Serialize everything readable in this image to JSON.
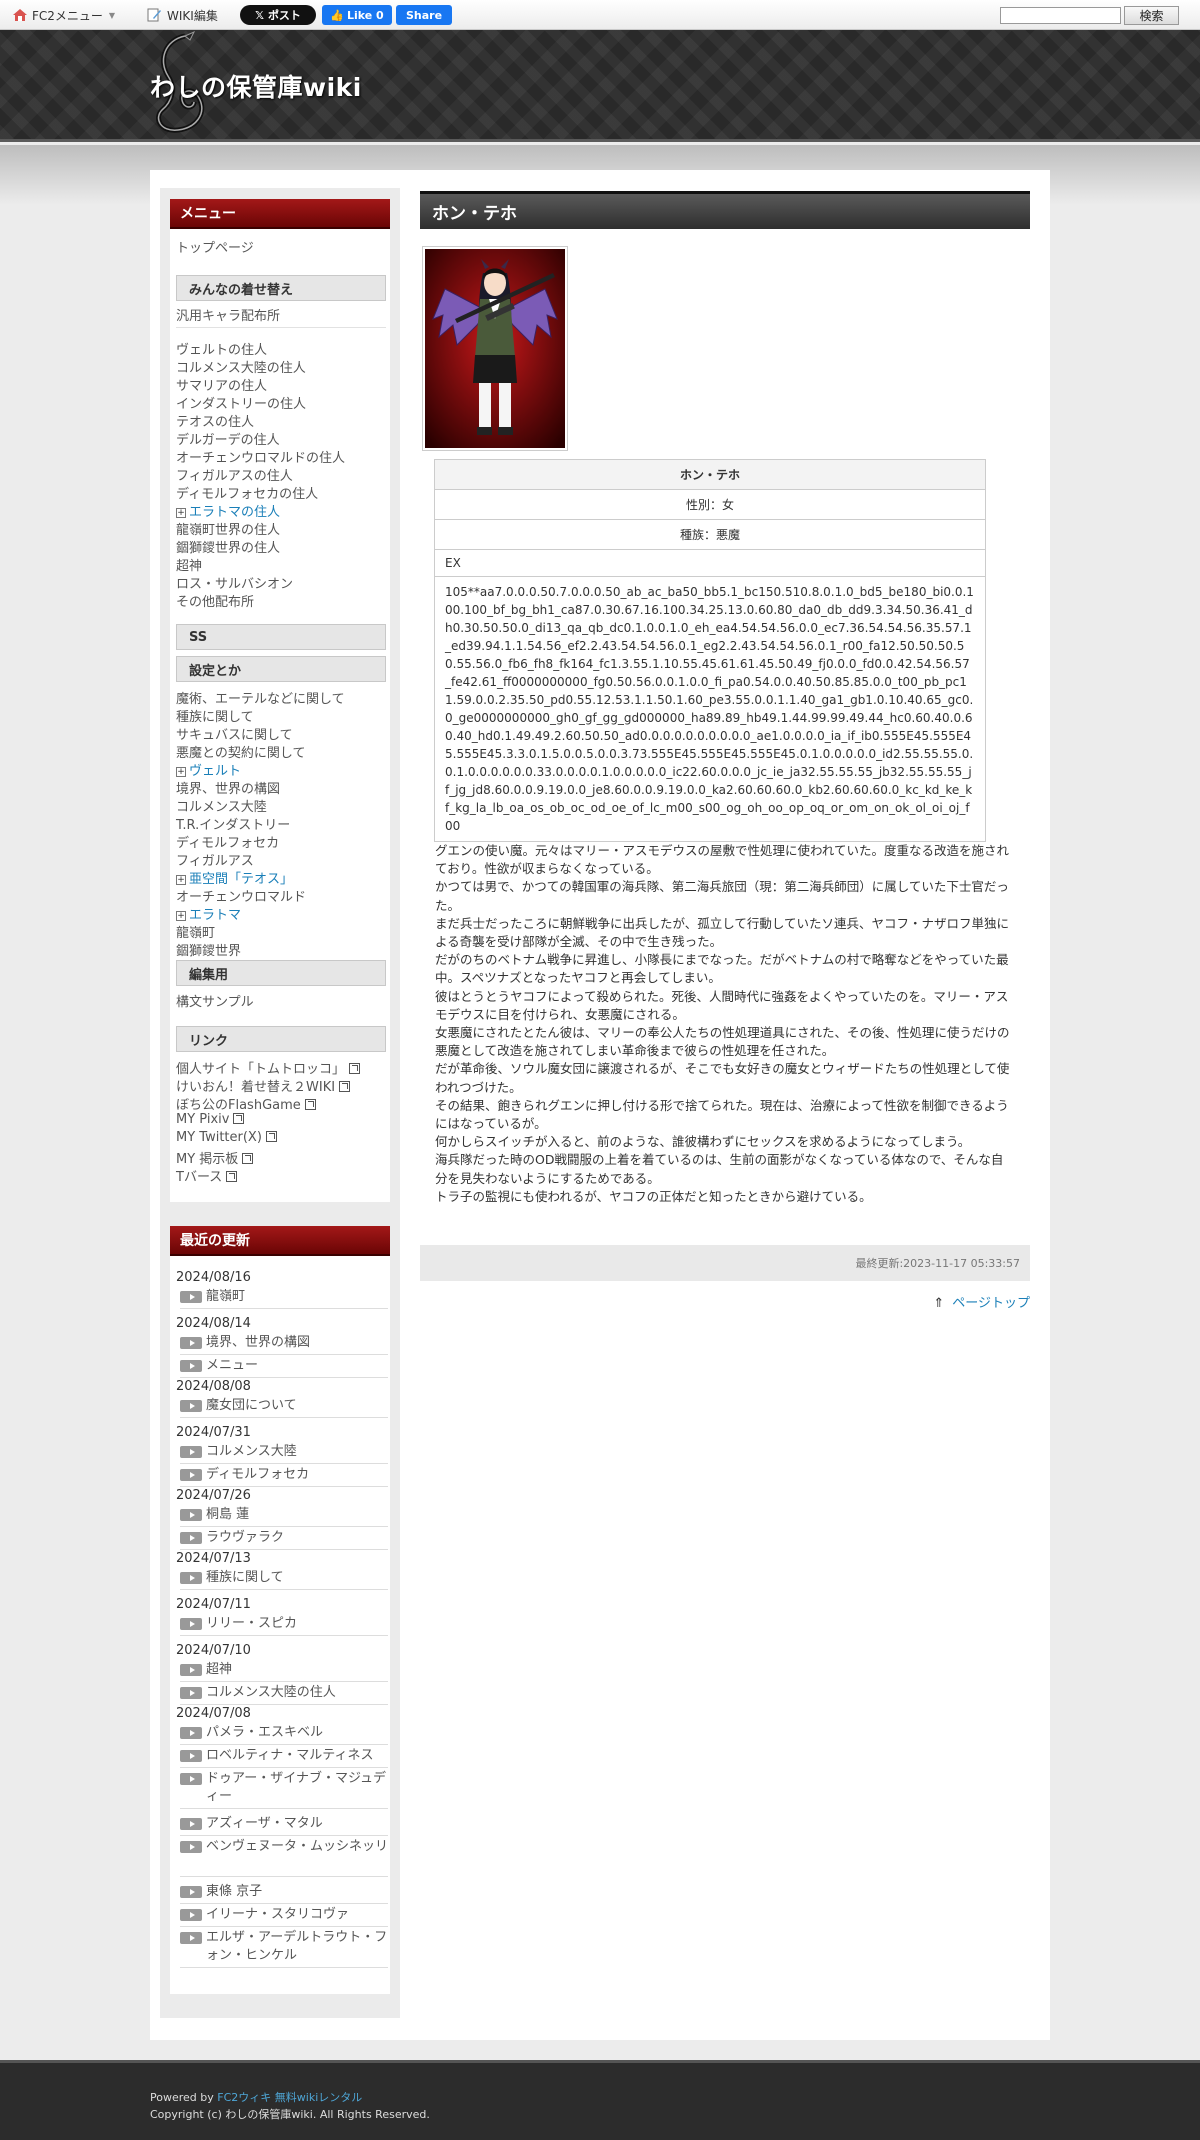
{
  "topbar": {
    "fc2_menu": "FC2メニュー",
    "wiki_edit": "WIKI編集",
    "x_post": "ポスト",
    "like": "Like 0",
    "share": "Share",
    "search_button": "検索"
  },
  "site": {
    "title": "わしの保管庫wiki"
  },
  "menu": {
    "title": "メニュー",
    "top_page": "トップページ",
    "section_dressup": "みんなの着せ替え",
    "generic_chars": "汎用キャラ配布所",
    "residents": [
      "ヴェルトの住人",
      "コルメンス大陸の住人",
      "サマリアの住人",
      "インダストリーの住人",
      "テオスの住人",
      "デルガーデの住人",
      "オーチェンウロマルドの住人",
      "フィガルアスの住人",
      "ディモルフォセカの住人"
    ],
    "eratoma_residents": "エラトマの住人",
    "residents2": [
      "龍嶺町世界の住人",
      "錮獅鑁世界の住人",
      "超神",
      "ロス・サルバシオン",
      "その他配布所"
    ],
    "section_ss": "SS",
    "section_settings": "設定とか",
    "settings1": [
      "魔術、エーテルなどに関して",
      "種族に関して",
      "サキュバスに関して",
      "悪魔との契約に関して"
    ],
    "velt": "ヴェルト",
    "settings2": [
      "境界、世界の構図",
      "コルメンス大陸",
      "T.R.インダストリー",
      "ディモルフォセカ",
      "フィガルアス"
    ],
    "theos": "亜空間「テオス」",
    "orchen": "オーチェンウロマルド",
    "eratoma": "エラトマ",
    "settings3": [
      "龍嶺町",
      "錮獅鑁世界"
    ],
    "section_edit": "編集用",
    "edit_sample": "構文サンプル",
    "section_links": "リンク",
    "links": [
      "個人サイト「トムトロッコ」",
      "けいおん！着せ替え２WIKI",
      "ぼち公のFlashGame",
      "MY Pixiv",
      "MY Twitter(X)",
      "MY 掲示板",
      "Tバース"
    ]
  },
  "recent": {
    "title": "最近の更新",
    "groups": [
      {
        "date": "2024/08/16",
        "items": [
          "龍嶺町"
        ]
      },
      {
        "date": "2024/08/14",
        "items": [
          "境界、世界の構図",
          "メニュー"
        ]
      },
      {
        "date": "2024/08/08",
        "items": [
          "魔女団について"
        ]
      },
      {
        "date": "2024/07/31",
        "items": [
          "コルメンス大陸",
          "ディモルフォセカ"
        ]
      },
      {
        "date": "2024/07/26",
        "items": [
          "桐島 蓮",
          "ラウヴァラク"
        ]
      },
      {
        "date": "2024/07/13",
        "items": [
          "種族に関して"
        ]
      },
      {
        "date": "2024/07/11",
        "items": [
          "リリー・スピカ"
        ]
      },
      {
        "date": "2024/07/10",
        "items": [
          "超神",
          "コルメンス大陸の住人"
        ]
      },
      {
        "date": "2024/07/08",
        "items": [
          "パメラ・エスキベル",
          "ロベルティナ・マルティネス",
          "ドゥアー・ザイナブ・マジュディー",
          "アズィーザ・マタル",
          "ベンヴェヌータ・ムッシネッリ",
          "東條 京子",
          "イリーナ・スタリコヴァ",
          "エルザ・アーデルトラウト・フォン・ヒンケル"
        ]
      }
    ]
  },
  "page": {
    "title": "ホン・テホ",
    "table_title": "ホン・テホ",
    "gender": "性別：女",
    "race": "種族：悪魔",
    "ex_label": "EX",
    "code": "105**aa7.0.0.0.50.7.0.0.0.50_ab_ac_ba50_bb5.1_bc150.510.8.0.1.0_bd5_be180_bi0.0.100.100_bf_bg_bh1_ca87.0.30.67.16.100.34.25.13.0.60.80_da0_db_dd9.3.34.50.36.41_dh0.30.50.50.0_di13_qa_qb_dc0.1.0.0.1.0_eh_ea4.54.54.56.0.0_ec7.36.54.54.56.35.57.1_ed39.94.1.1.54.56_ef2.2.43.54.54.56.0.1_eg2.2.43.54.54.56.0.1_r00_fa12.50.50.50.50.55.56.0_fb6_fh8_fk164_fc1.3.55.1.10.55.45.61.61.45.50.49_fj0.0.0_fd0.0.42.54.56.57_fe42.61_ff0000000000_fg0.50.56.0.0.1.0.0_fi_pa0.54.0.0.40.50.85.85.0.0_t00_pb_pc11.59.0.0.2.35.50_pd0.55.12.53.1.1.50.1.60_pe3.55.0.0.1.1.40_ga1_gb1.0.10.40.65_gc0.0_ge0000000000_gh0_gf_gg_gd000000_ha89.89_hb49.1.44.99.99.49.44_hc0.60.40.0.60.40_hd0.1.49.49.2.60.50.50_ad0.0.0.0.0.0.0.0.0.0_ae1.0.0.0.0_ia_if_ib0.555E45.555E45.555E45.3.3.0.1.5.0.0.5.0.0.3.73.555E45.555E45.555E45.0.1.0.0.0.0.0_id2.55.55.55.0.0.1.0.0.0.0.0.0.33.0.0.0.0.1.0.0.0.0.0_ic22.60.0.0.0_jc_ie_ja32.55.55.55_jb32.55.55.55_jf_jg_jd8.60.0.0.9.19.0.0_je8.60.0.0.9.19.0.0_ka2.60.60.60.0_kb2.60.60.60.0_kc_kd_ke_kf_kg_la_lb_oa_os_ob_oc_od_oe_of_lc_m00_s00_og_oh_oo_op_oq_or_om_on_ok_ol_oi_oj_f00",
    "story": [
      "グエンの使い魔。元々はマリー・アスモデウスの屋敷で性処理に使われていた。度重なる改造を施されており。性欲が収まらなくなっている。",
      "かつては男で、かつての韓国軍の海兵隊、第二海兵旅団（現：第二海兵師団）に属していた下士官だった。",
      "まだ兵士だったころに朝鮮戦争に出兵したが、孤立して行動していたソ連兵、ヤコフ・ナザロフ単独による奇襲を受け部隊が全滅、その中で生き残った。",
      "だがのちのベトナム戦争に昇進し、小隊長にまでなった。だがベトナムの村で略奪などをやっていた最中。スペツナズとなったヤコフと再会してしまい。",
      "彼はとうとうヤコフによって殺められた。死後、人間時代に強姦をよくやっていたのを。マリー・アスモデウスに目を付けられ、女悪魔にされる。",
      "女悪魔にされたとたん彼は、マリーの奉公人たちの性処理道具にされた、その後、性処理に使うだけの悪魔として改造を施されてしまい革命後まで彼らの性処理を任された。",
      "だが革命後、ソウル魔女団に譲渡されるが、そこでも女好きの魔女とウィザードたちの性処理として使われつづけた。",
      "その結果、飽きられグエンに押し付ける形で捨てられた。現在は、治療によって性欲を制御できるようにはなっているが。",
      "何かしらスイッチが入ると、前のような、誰彼構わずにセックスを求めるようになってしまう。",
      "海兵隊だった時のOD戦闘服の上着を着ているのは、生前の面影がなくなっている体なので、そんな自分を見失わないようにするためである。",
      "トラ子の監視にも使われるが、ヤコフの正体だと知ったときから避けている。"
    ],
    "last_updated": "最終更新:2023-11-17 05:33:57",
    "page_top": "ページトップ"
  },
  "footer": {
    "powered_prefix": "Powered by ",
    "powered_link": "FC2ウィキ 無料wikiレンタル",
    "copyright": "Copyright (c) わしの保管庫wiki. All Rights Reserved."
  }
}
